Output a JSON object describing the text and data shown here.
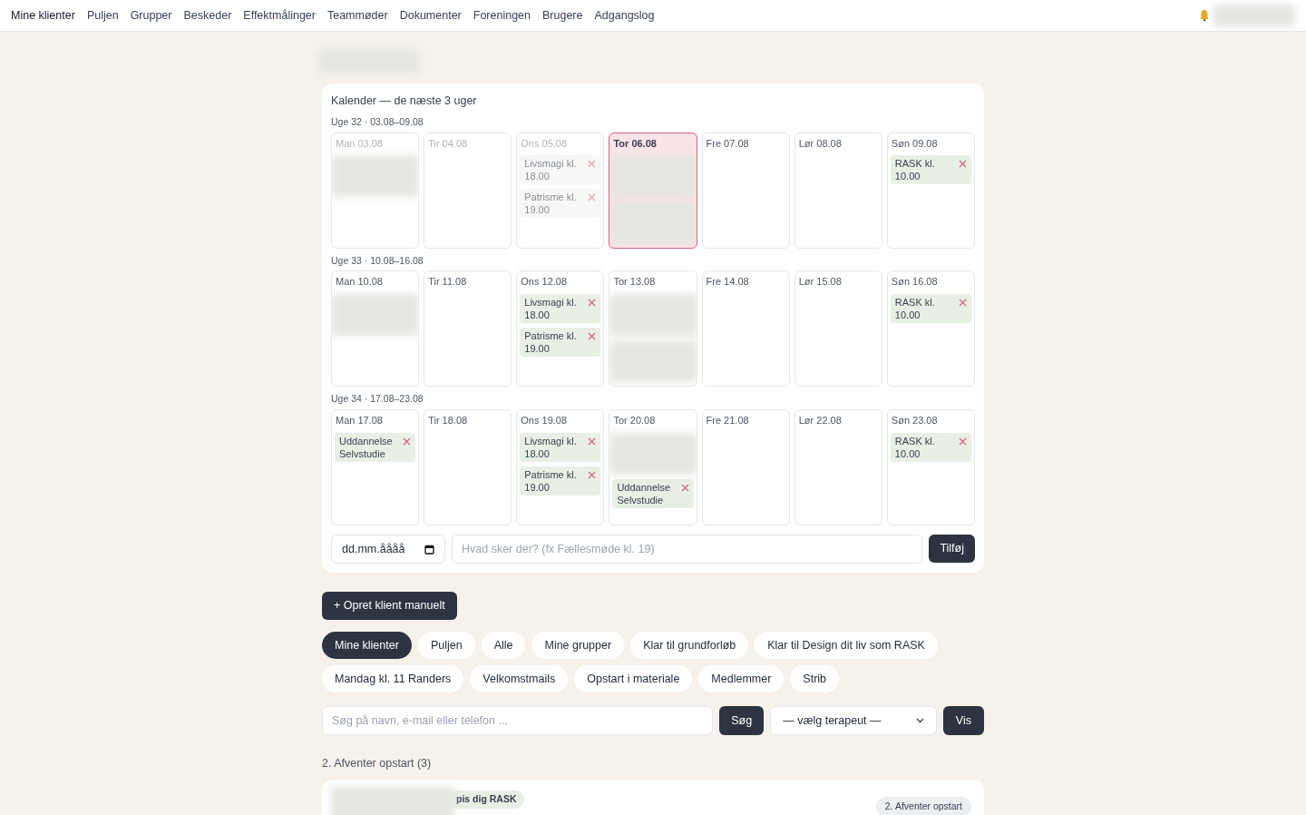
{
  "nav": {
    "items": [
      {
        "label": "Mine klienter",
        "selected": true
      },
      {
        "label": "Puljen",
        "selected": false
      },
      {
        "label": "Grupper",
        "selected": false
      },
      {
        "label": "Beskeder",
        "selected": false
      },
      {
        "label": "Effektmålinger",
        "selected": false
      },
      {
        "label": "Teammøder",
        "selected": false
      },
      {
        "label": "Dokumenter",
        "selected": false
      },
      {
        "label": "Foreningen",
        "selected": false
      },
      {
        "label": "Brugere",
        "selected": false
      },
      {
        "label": "Adgangslog",
        "selected": false
      }
    ]
  },
  "calendar": {
    "title": "Kalender — de næste 3 uger",
    "weeks": [
      {
        "label": "Uge 32 · 03.08–09.08",
        "days": [
          {
            "label": "Man 03.08",
            "past": true,
            "today": false,
            "events": [
              {
                "kind": "blurred"
              }
            ]
          },
          {
            "label": "Tir 04.08",
            "past": true,
            "today": false
          },
          {
            "label": "Ons 05.08",
            "past": true,
            "today": false,
            "events": [
              {
                "kind": "event",
                "text": "Livsmagi kl. 18.00"
              },
              {
                "kind": "event",
                "text": "Patrisme kl. 19.00"
              }
            ]
          },
          {
            "label": "Tor 06.08",
            "past": false,
            "today": true,
            "events": [
              {
                "kind": "blurred"
              },
              {
                "kind": "blurred"
              }
            ]
          },
          {
            "label": "Fre 07.08",
            "past": false,
            "today": false
          },
          {
            "label": "Lør 08.08",
            "past": false,
            "today": false
          },
          {
            "label": "Søn 09.08",
            "past": false,
            "today": false,
            "events": [
              {
                "kind": "event",
                "text": "RASK kl. 10.00"
              }
            ]
          }
        ]
      },
      {
        "label": "Uge 33 · 10.08–16.08",
        "days": [
          {
            "label": "Man 10.08",
            "past": false,
            "today": false,
            "events": [
              {
                "kind": "blurred"
              }
            ]
          },
          {
            "label": "Tir 11.08",
            "past": false,
            "today": false
          },
          {
            "label": "Ons 12.08",
            "past": false,
            "today": false,
            "events": [
              {
                "kind": "event",
                "text": "Livsmagi kl. 18.00"
              },
              {
                "kind": "event",
                "text": "Patrisme kl. 19.00"
              }
            ]
          },
          {
            "label": "Tor 13.08",
            "past": false,
            "today": false,
            "events": [
              {
                "kind": "blurred"
              },
              {
                "kind": "blurred"
              }
            ]
          },
          {
            "label": "Fre 14.08",
            "past": false,
            "today": false
          },
          {
            "label": "Lør 15.08",
            "past": false,
            "today": false
          },
          {
            "label": "Søn 16.08",
            "past": false,
            "today": false,
            "events": [
              {
                "kind": "event",
                "text": "RASK kl. 10.00"
              }
            ]
          }
        ]
      },
      {
        "label": "Uge 34 · 17.08–23.08",
        "days": [
          {
            "label": "Man 17.08",
            "past": false,
            "today": false,
            "events": [
              {
                "kind": "event",
                "text": "Uddannelse Selvstudie"
              }
            ]
          },
          {
            "label": "Tir 18.08",
            "past": false,
            "today": false
          },
          {
            "label": "Ons 19.08",
            "past": false,
            "today": false,
            "events": [
              {
                "kind": "event",
                "text": "Livsmagi kl. 18.00"
              },
              {
                "kind": "event",
                "text": "Patrisme kl. 19.00"
              }
            ]
          },
          {
            "label": "Tor 20.08",
            "past": false,
            "today": false,
            "events": [
              {
                "kind": "blurred"
              },
              {
                "kind": "event",
                "text": "Uddannelse Selvstudie"
              }
            ]
          },
          {
            "label": "Fre 21.08",
            "past": false,
            "today": false
          },
          {
            "label": "Lør 22.08",
            "past": false,
            "today": false
          },
          {
            "label": "Søn 23.08",
            "past": false,
            "today": false,
            "events": [
              {
                "kind": "event",
                "text": "RASK kl. 10.00"
              }
            ]
          }
        ]
      }
    ],
    "date_field": {
      "value": "dd.mm.åååå"
    },
    "event_field": {
      "placeholder": "Hvad sker der? (fx Fællesmøde kl. 19)"
    },
    "add_button": "Tilføj"
  },
  "create_button": "+ Opret klient manuelt",
  "filters": [
    {
      "label": "Mine klienter",
      "selected": true
    },
    {
      "label": "Puljen",
      "selected": false
    },
    {
      "label": "Alle",
      "selected": false
    },
    {
      "label": "Mine grupper",
      "selected": false
    },
    {
      "label": "Klar til grundforløb",
      "selected": false
    },
    {
      "label": "Klar til Design dit liv som RASK",
      "selected": false
    },
    {
      "label": "Mandag kl. 11 Randers",
      "selected": false
    },
    {
      "label": "Velkomstmails",
      "selected": false
    },
    {
      "label": "Opstart i materiale",
      "selected": false
    },
    {
      "label": "Medlemmer",
      "selected": false
    },
    {
      "label": "Strib",
      "selected": false
    }
  ],
  "search": {
    "placeholder": "Søg på navn, e-mail eller telefon ...",
    "button": "Søg"
  },
  "therapist_select": {
    "value": "— vælg terapeut —",
    "button": "Vis"
  },
  "section": {
    "title": "2. Afventer opstart (3)",
    "clients": [
      {
        "tag": "pis dig RASK",
        "status": "2. Afventer opstart"
      }
    ]
  }
}
